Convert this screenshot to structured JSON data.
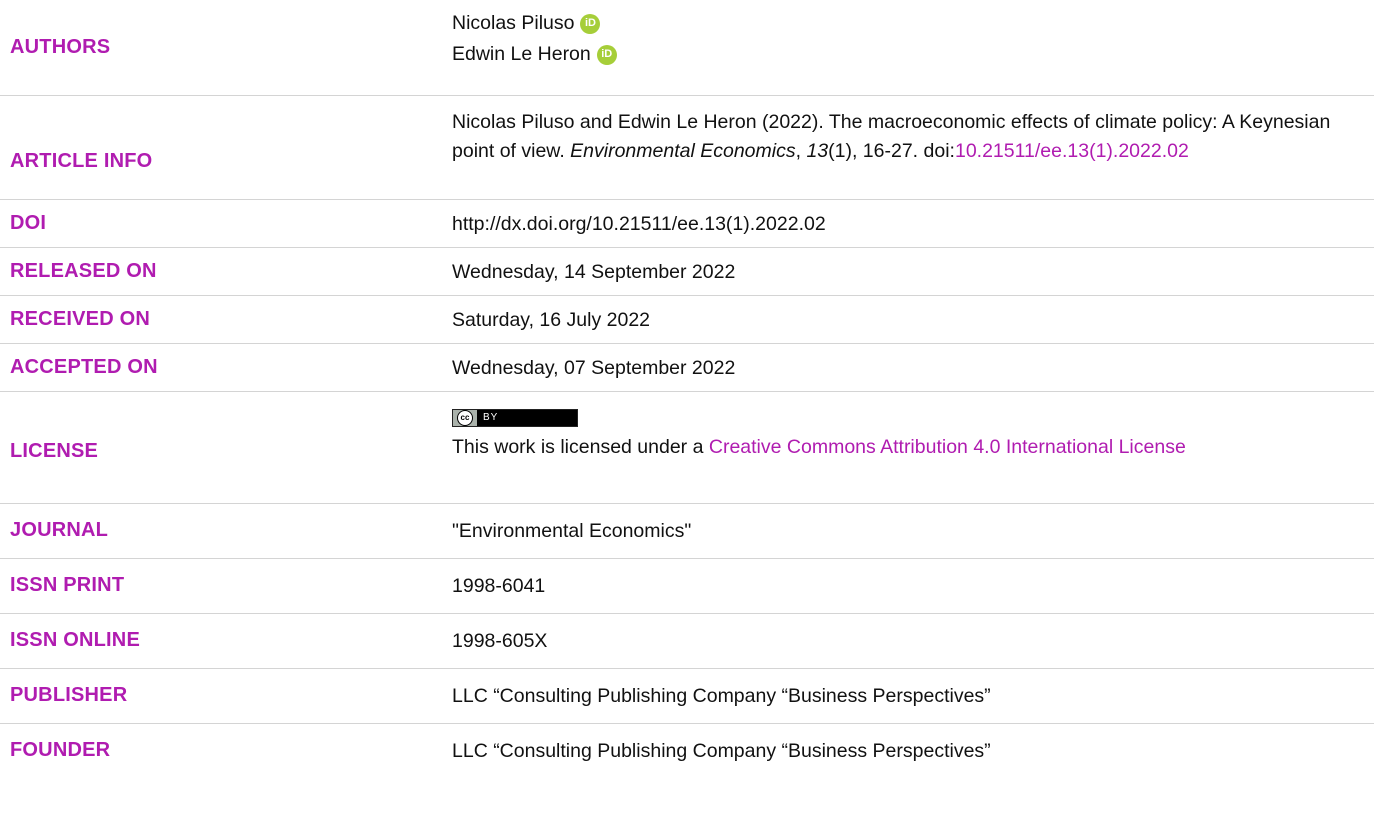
{
  "rows": [
    {
      "label": "AUTHORS"
    },
    {
      "label": "ARTICLE INFO"
    },
    {
      "label": "DOI",
      "value": "http://dx.doi.org/10.21511/ee.13(1).2022.02"
    },
    {
      "label": "RELEASED ON",
      "value": "Wednesday, 14 September 2022"
    },
    {
      "label": "RECEIVED ON",
      "value": "Saturday, 16 July 2022"
    },
    {
      "label": "ACCEPTED ON",
      "value": "Wednesday, 07 September 2022"
    },
    {
      "label": "LICENSE"
    },
    {
      "label": "JOURNAL",
      "value": "\"Environmental Economics\""
    },
    {
      "label": "ISSN PRINT",
      "value": "1998-6041"
    },
    {
      "label": "ISSN ONLINE",
      "value": "1998-605X"
    },
    {
      "label": "PUBLISHER",
      "value": "LLC “Consulting Publishing Company “Business Perspectives”"
    },
    {
      "label": "FOUNDER",
      "value": "LLC “Consulting Publishing Company “Business Perspectives”"
    }
  ],
  "authors": [
    {
      "name": "Nicolas Piluso",
      "orcid_icon_text": "iD"
    },
    {
      "name": "Edwin Le Heron",
      "orcid_icon_text": "iD"
    }
  ],
  "article_info": {
    "prefix": "Nicolas Piluso and Edwin Le Heron (2022). The macroeconomic effects of climate policy: A Keynesian point of view. ",
    "journal": "Environmental Economics",
    "sep1": ", ",
    "volume": "13",
    "issue_pages": "(1), 16-27. doi:",
    "doi_link": "10.21511/ee.13(1).2022.02"
  },
  "license": {
    "badge_cc": "cc",
    "badge_by": "BY",
    "text_prefix": "This work is licensed under a ",
    "link_text": "Creative Commons Attribution 4.0 International License"
  },
  "colors": {
    "label": "#b01cb0",
    "link": "#b01cb0",
    "text": "#111111",
    "divider": "#d4d4d4",
    "orcid": "#a6ce39"
  }
}
